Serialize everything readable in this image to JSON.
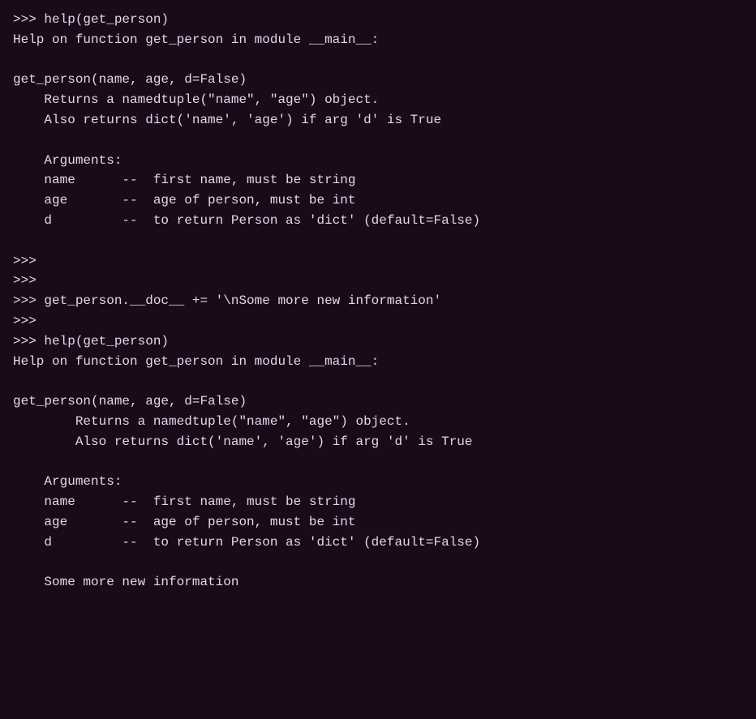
{
  "terminal": {
    "background": "#1a0a1a",
    "text_color": "#e8d5e8",
    "lines": [
      ">>> help(get_person)",
      "Help on function get_person in module __main__:",
      "",
      "get_person(name, age, d=False)",
      "    Returns a namedtuple(\"name\", \"age\") object.",
      "    Also returns dict('name', 'age') if arg 'd' is True",
      "",
      "    Arguments:",
      "    name      --  first name, must be string",
      "    age       --  age of person, must be int",
      "    d         --  to return Person as 'dict' (default=False)",
      "",
      ">>>",
      ">>>",
      ">>> get_person.__doc__ += '\\nSome more new information'",
      ">>>",
      ">>> help(get_person)",
      "Help on function get_person in module __main__:",
      "",
      "get_person(name, age, d=False)",
      "        Returns a namedtuple(\"name\", \"age\") object.",
      "        Also returns dict('name', 'age') if arg 'd' is True",
      "",
      "    Arguments:",
      "    name      --  first name, must be string",
      "    age       --  age of person, must be int",
      "    d         --  to return Person as 'dict' (default=False)",
      "",
      "    Some more new information"
    ]
  }
}
